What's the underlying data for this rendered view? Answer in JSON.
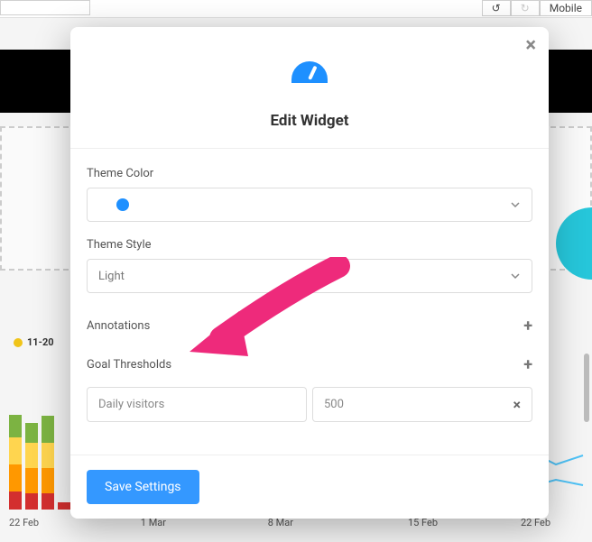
{
  "toolbar": {
    "mobile_label": "Mobile"
  },
  "legend": {
    "range": "11-20"
  },
  "bg_chart": {
    "ticks": [
      "22 Feb",
      "1 Mar",
      "8 Mar"
    ]
  },
  "bg_line": {
    "ticks": [
      "15 Feb",
      "22 Feb"
    ]
  },
  "modal": {
    "title": "Edit Widget",
    "theme_color_label": "Theme Color",
    "theme_style_label": "Theme Style",
    "theme_style_value": "Light",
    "annotations_label": "Annotations",
    "goal_thresholds_label": "Goal Thresholds",
    "threshold": {
      "name": "Daily visitors",
      "value": "500"
    },
    "save_label": "Save Settings"
  },
  "colors": {
    "accent": "#1e90ff",
    "save_btn": "#3498ff",
    "arrow": "#ee2a7b"
  }
}
